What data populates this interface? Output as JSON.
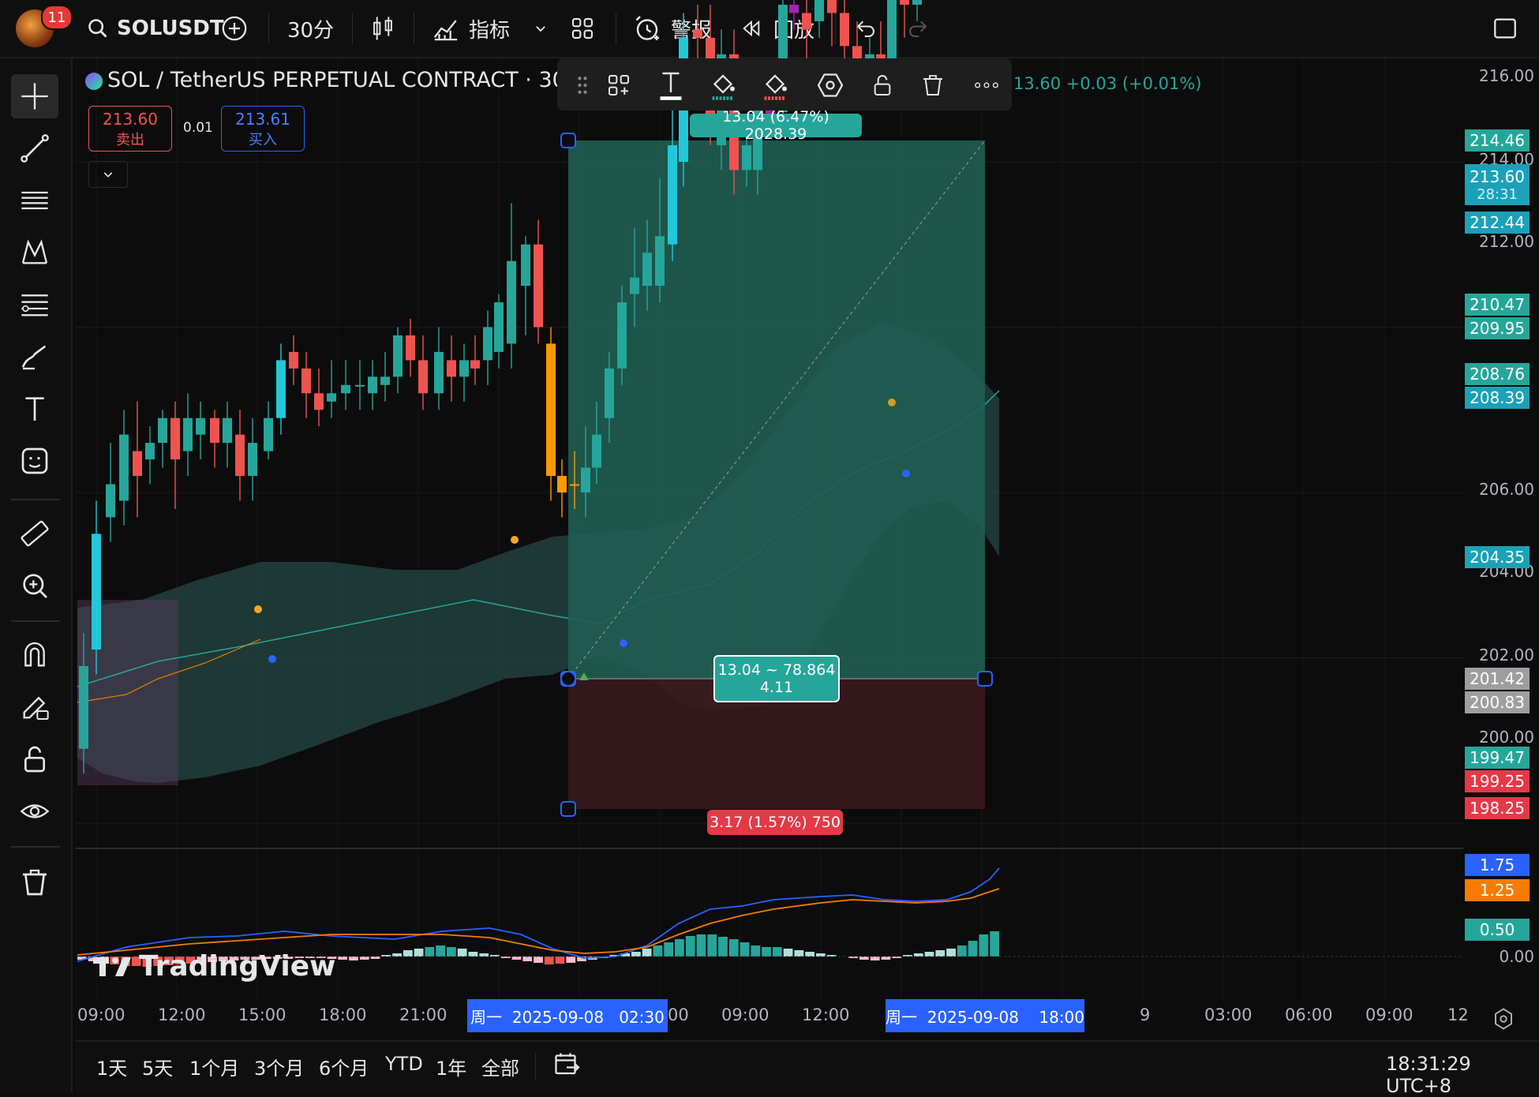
{
  "topbar": {
    "notification_count": "11",
    "symbol": "SOLUSDT",
    "interval": "30分",
    "indicators_label": "指标",
    "alert_label": "警报",
    "replay_label": "回放"
  },
  "legend": {
    "title": "SOL / TetherUS PERPETUAL CONTRACT · 30 · ",
    "change": "13.60  +0.03 (+0.01%)"
  },
  "trade": {
    "sell_price": "213.60",
    "sell_label": "卖出",
    "spread": "0.01",
    "buy_price": "213.61",
    "buy_label": "买入"
  },
  "position": {
    "target_label": "13.04 (6.47%) 2028.39",
    "center_line1": "13.04 ~ 78.864",
    "center_line2": "4.11",
    "stop_label": "3.17 (1.57%) 750"
  },
  "price_axis": {
    "labels": [
      "216.00",
      "214.00",
      "212.00",
      "206.00",
      "204.00",
      "202.00",
      "200.00",
      "0.00"
    ],
    "tags": {
      "t1": "214.46",
      "t2": "213.60",
      "t2b": "28:31",
      "t3": "212.44",
      "t4": "210.47",
      "t5": "209.95",
      "t6": "208.76",
      "t7": "208.39",
      "t8": "204.35",
      "t9": "201.42",
      "t10": "200.83",
      "t11": "199.47",
      "t12": "199.25",
      "t13": "198.25",
      "m1": "1.75",
      "m2": "1.25",
      "m3": "0.50"
    }
  },
  "time_axis": {
    "labels": [
      "09:00",
      "12:00",
      "15:00",
      "18:00",
      "21:00",
      "00",
      "09:00",
      "12:00",
      "9",
      "03:00",
      "06:00",
      "09:00",
      "12"
    ],
    "cursor_start": "周一  2025-09-08   02:30",
    "cursor_end": "周一  2025-09-08    18:00"
  },
  "watermark": "TradingView",
  "bottom": {
    "ranges": [
      "1天",
      "5天",
      "1个月",
      "3个月",
      "6个月",
      "YTD",
      "1年",
      "全部"
    ],
    "clock": "18:31:29 UTC+8"
  },
  "colors": {
    "up": "#26a69a",
    "up_bright": "#22c7d8",
    "down": "#ef5350",
    "target_fill": "#1f5d52",
    "stop_fill": "#3a1a1e",
    "bb_fill": "#2e5d57"
  }
}
